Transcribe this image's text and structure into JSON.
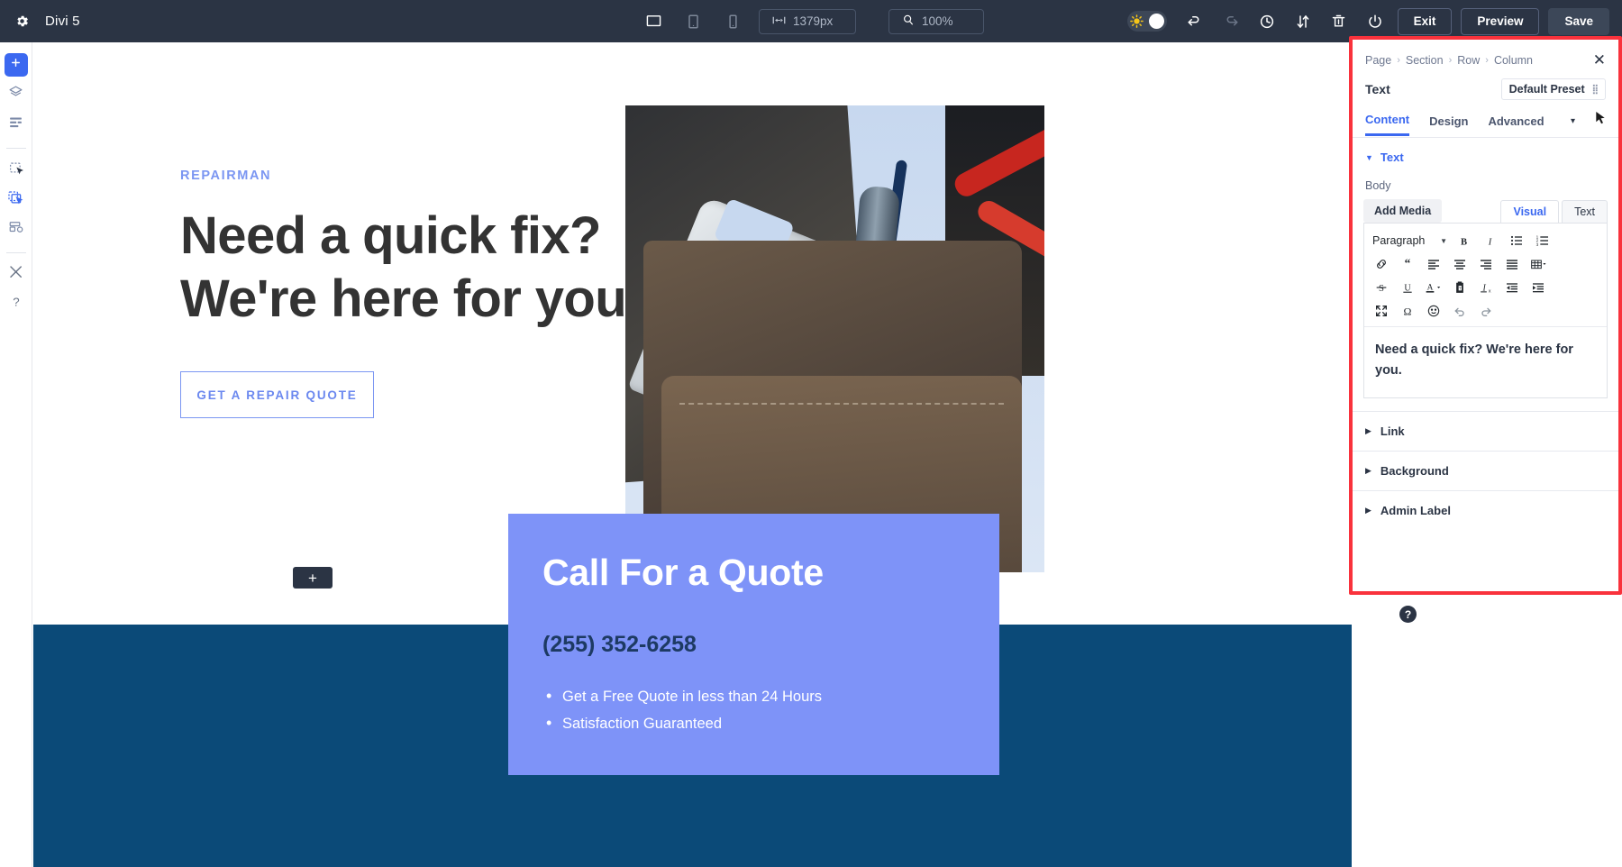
{
  "topbar": {
    "gear_icon": "gear-icon",
    "title": "Divi 5",
    "devices": [
      {
        "name": "desktop",
        "icon": "desktop-icon",
        "active": true
      },
      {
        "name": "tablet",
        "icon": "tablet-icon",
        "active": false
      },
      {
        "name": "phone",
        "icon": "phone-icon",
        "active": false
      }
    ],
    "width_value": "1379px",
    "width_icon": "width-arrows-icon",
    "zoom_value": "100%",
    "zoom_icon": "magnifier-icon",
    "theme_toggle_icon": "sun-icon",
    "actions": [
      {
        "name": "undo",
        "icon": "undo-icon"
      },
      {
        "name": "redo",
        "icon": "redo-icon"
      },
      {
        "name": "history",
        "icon": "clock-icon"
      },
      {
        "name": "portability",
        "icon": "import-export-icon"
      },
      {
        "name": "trash",
        "icon": "trash-icon"
      },
      {
        "name": "power",
        "icon": "power-icon"
      }
    ],
    "exit_label": "Exit",
    "preview_label": "Preview",
    "save_label": "Save"
  },
  "rail": {
    "items": [
      {
        "name": "add-module",
        "icon": "plus-icon",
        "active": true
      },
      {
        "name": "layers",
        "icon": "layers-icon",
        "active": false
      },
      {
        "name": "list-view",
        "icon": "list-icon",
        "active": false
      },
      {
        "name": "section-select",
        "icon": "section-select-icon",
        "active": false
      },
      {
        "name": "module-select",
        "icon": "module-select-icon",
        "active": true
      },
      {
        "name": "presets",
        "icon": "presets-icon",
        "active": false
      },
      {
        "name": "tools",
        "icon": "wrench-tools-icon",
        "active": false
      },
      {
        "name": "help",
        "icon": "question-mark-icon",
        "active": false
      }
    ]
  },
  "canvas": {
    "hero": {
      "eyebrow": "REPAIRMAN",
      "heading": "Need a quick fix? We're here for you.",
      "cta_label": "GET A REPAIR QUOTE",
      "add_module_label": "+"
    },
    "quote_card": {
      "title": "Call For a Quote",
      "phone": "(255) 352-6258",
      "bullets": [
        "Get a Free Quote in less than 24 Hours",
        "Satisfaction Guaranteed"
      ]
    }
  },
  "panel": {
    "breadcrumbs": [
      "Page",
      "Section",
      "Row",
      "Column"
    ],
    "breadcrumb_sep": "›",
    "close_icon": "close-icon",
    "close_glyph": "✕",
    "module_title": "Text",
    "preset_label": "Default Preset",
    "tabs": [
      {
        "label": "Content",
        "active": true
      },
      {
        "label": "Design",
        "active": false
      },
      {
        "label": "Advanced",
        "active": false
      }
    ],
    "tabs_caret_icon": "chevron-down-icon",
    "cursor_icon": "mouse-pointer-icon",
    "section": {
      "toggle_icon": "triangle-down-icon",
      "label": "Text"
    },
    "body_field_label": "Body",
    "add_media_label": "Add Media",
    "editor_tabs": [
      {
        "label": "Visual",
        "active": true
      },
      {
        "label": "Text",
        "active": false
      }
    ],
    "toolbar": {
      "paragraph_label": "Paragraph",
      "row1": [
        "bold-icon",
        "italic-icon",
        "bulleted-list-icon",
        "numbered-list-icon"
      ],
      "row2": [
        "link-icon",
        "blockquote-icon",
        "align-left-icon",
        "align-center-icon",
        "align-right-icon",
        "align-justify-icon",
        "table-icon"
      ],
      "row3": [
        "strikethrough-icon",
        "underline-icon",
        "text-color-icon",
        "paste-as-text-icon",
        "clear-formatting-icon",
        "outdent-icon",
        "indent-icon"
      ],
      "row4": [
        "fullscreen-icon",
        "special-character-icon",
        "emoji-icon",
        "undo-icon",
        "redo-icon"
      ]
    },
    "editor_content": "Need a quick fix? We're here for you.",
    "accordion": [
      {
        "label": "Link",
        "icon": "triangle-right-icon"
      },
      {
        "label": "Background",
        "icon": "triangle-right-icon"
      },
      {
        "label": "Admin Label",
        "icon": "triangle-right-icon"
      }
    ],
    "help_label": "?",
    "highlight_color": "#f9323c"
  },
  "colors": {
    "topbar_bg": "#2b3444",
    "accent_blue": "#3b68f0",
    "hero_text": "#333333",
    "card_blue": "#7e93f8",
    "section_blue": "#0b4a78",
    "highlight_red": "#f9323c"
  }
}
